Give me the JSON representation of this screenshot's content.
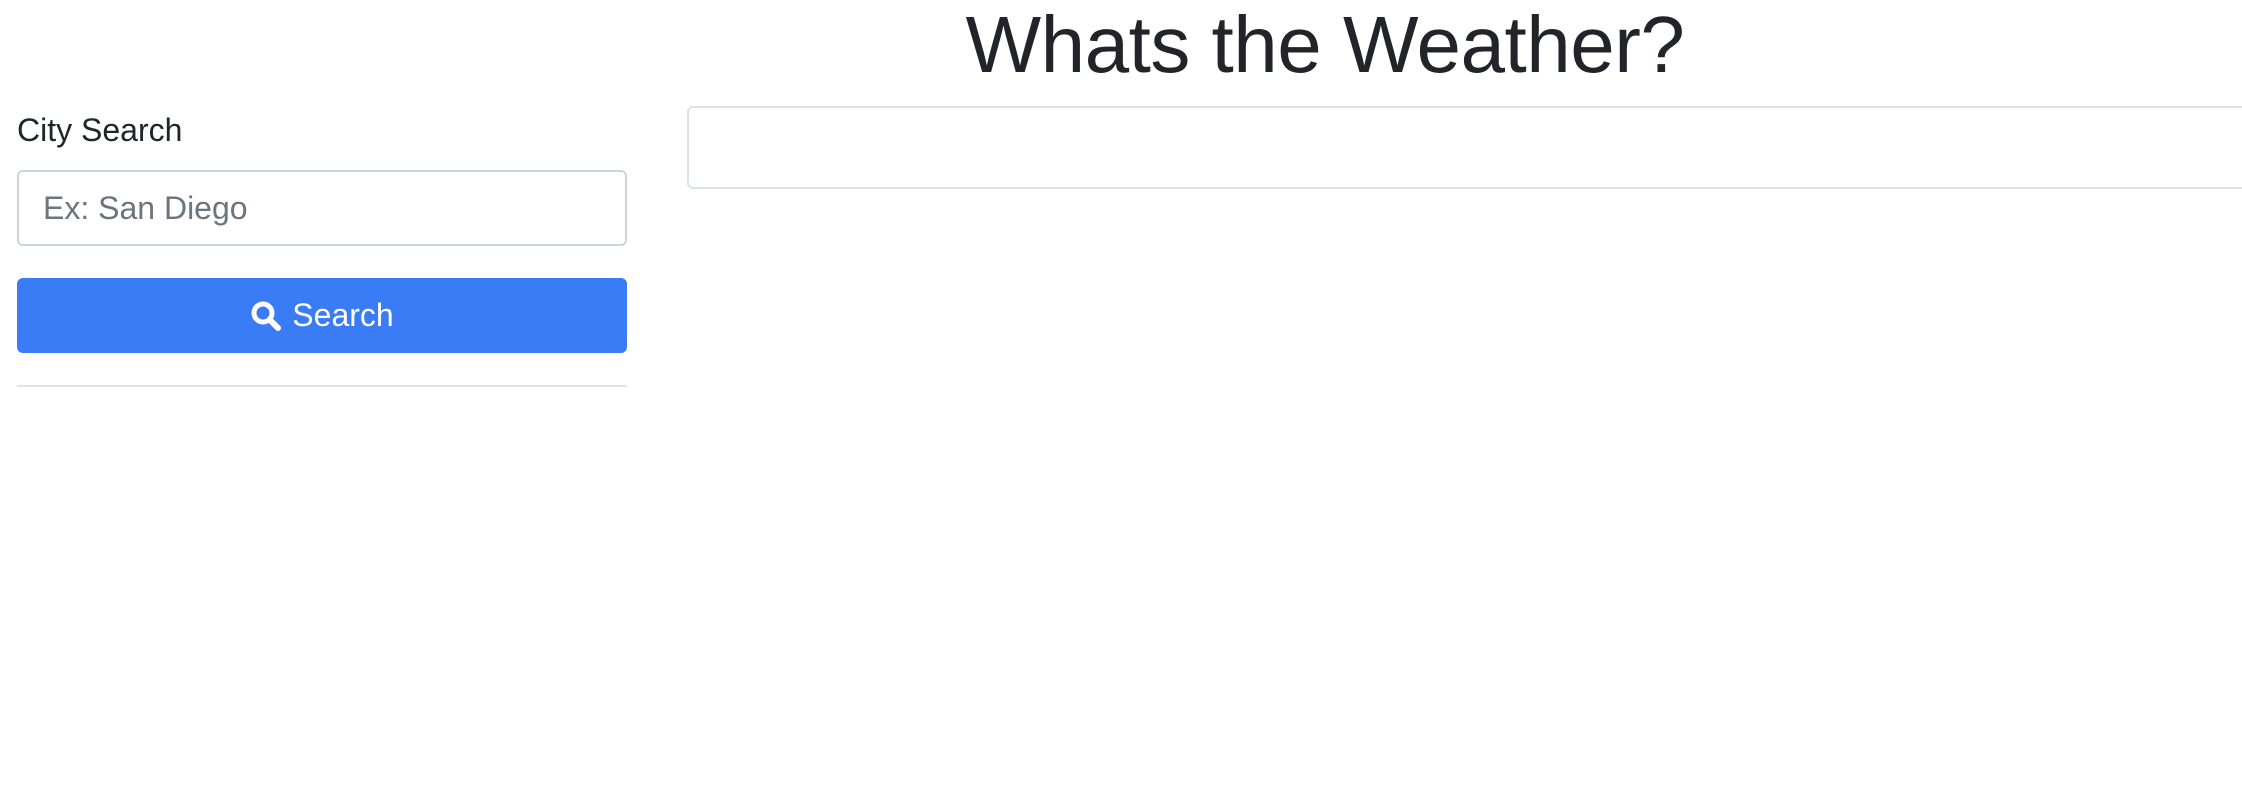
{
  "header": {
    "title": "Whats the Weather?"
  },
  "sidebar": {
    "label": "City Search",
    "input": {
      "placeholder": "Ex: San Diego",
      "value": ""
    },
    "search_button": {
      "label": "Search",
      "icon": "search-icon"
    }
  },
  "colors": {
    "primary_button": "#3a7cf5",
    "text": "#212529",
    "input_border": "#ced4da"
  }
}
